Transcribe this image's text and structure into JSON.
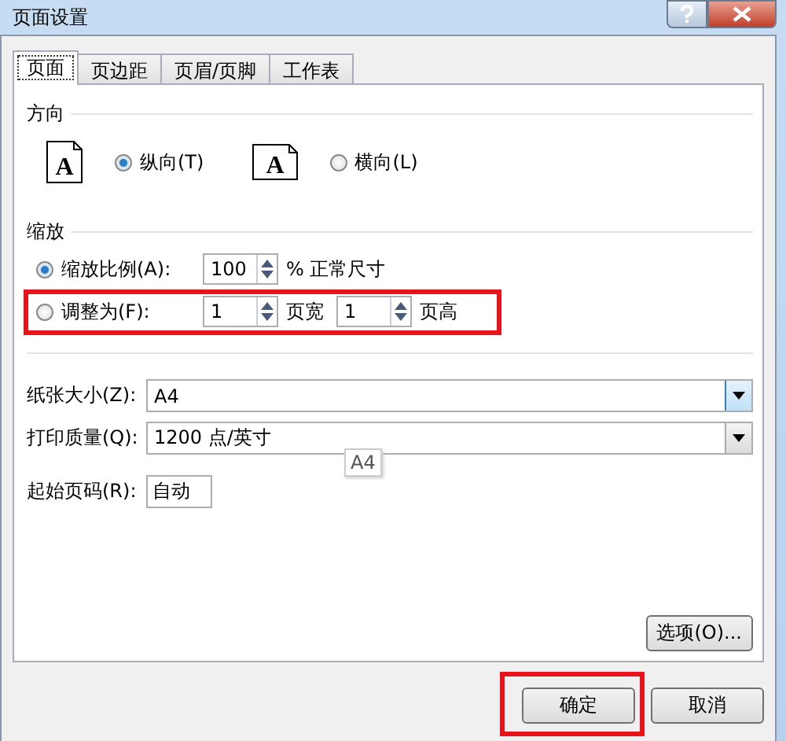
{
  "window": {
    "title": "页面设置"
  },
  "tabs": [
    {
      "label": "页面",
      "selected": true
    },
    {
      "label": "页边距",
      "selected": false
    },
    {
      "label": "页眉/页脚",
      "selected": false
    },
    {
      "label": "工作表",
      "selected": false
    }
  ],
  "orientation": {
    "heading": "方向",
    "options": [
      {
        "label": "纵向(T)",
        "selected": true,
        "kind": "portrait",
        "icon_letter": "A"
      },
      {
        "label": "横向(L)",
        "selected": false,
        "kind": "landscape",
        "icon_letter": "A"
      }
    ]
  },
  "scaling": {
    "heading": "缩放",
    "options": [
      {
        "label": "缩放比例(A):",
        "selected": true,
        "highlighted": false,
        "fields": [
          {
            "value": "100",
            "unit": "% 正常尺寸"
          }
        ]
      },
      {
        "label": "调整为(F):",
        "selected": false,
        "highlighted": true,
        "fields": [
          {
            "value": "1",
            "unit": "页宽"
          },
          {
            "value": "1",
            "unit": "页高"
          }
        ]
      }
    ]
  },
  "paper_size": {
    "label": "纸张大小(Z):",
    "value": "A4"
  },
  "print_quality": {
    "label": "打印质量(Q):",
    "value": "1200 点/英寸"
  },
  "tooltip": "A4",
  "first_page": {
    "label": "起始页码(R):",
    "value": "自动"
  },
  "options_button": "选项(O)...",
  "buttons": [
    {
      "label": "确定",
      "highlighted": true
    },
    {
      "label": "取消",
      "highlighted": false
    }
  ]
}
